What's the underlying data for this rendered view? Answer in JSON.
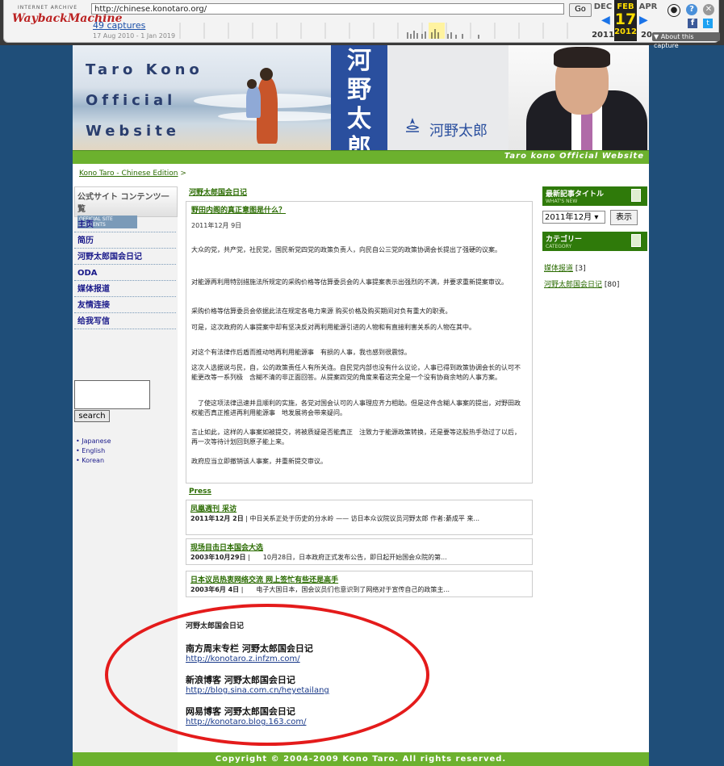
{
  "wayback": {
    "logo_line1": "INTERNET ARCHIVE",
    "logo_line2": "WaybackMachine",
    "url": "http://chinese.konotaro.org/",
    "go_label": "Go",
    "captures": "49 captures",
    "range": "17 Aug 2010 - 1 Jan 2019",
    "prev_month": "DEC",
    "prev_year": "2011",
    "cur_month": "FEB",
    "cur_day": "17",
    "cur_year": "2012",
    "next_month": "APR",
    "next_year": "20",
    "about": "▼ About this capture",
    "accent": "#ffde00"
  },
  "banner": {
    "title_lines": [
      "Taro Kono",
      "Official",
      "Website"
    ],
    "name_vertical": "河野太郎",
    "signature": "河野太郎",
    "tagline": "Taro kono Official Website"
  },
  "breadcrumb": {
    "link": "Kono Taro - Chinese Edition",
    "sep": ">"
  },
  "sidebar": {
    "heading": "公式サイト コンテンツ一覧",
    "subheading": "OFFICIAL SITE CONTENTS",
    "items": [
      "主页",
      "简历",
      "河野太郎国会日记",
      "ODA",
      "媒体报道",
      "友情连接",
      "给我写信"
    ],
    "search_label": "search",
    "languages": [
      "• Japanese",
      "• English",
      "• Korean"
    ]
  },
  "main": {
    "section_title": "河野太郎国会日记",
    "article": {
      "title": "野田内阁的真正意图是什么？",
      "date": "2011年12月 9日",
      "paragraphs": [
        "大众的党，共产党，社民党，国民新党四党的政策负责人，向民自公三党的政策协调会长提出了强硬的议案。",
        "对能源再利用特别措施法所规定的采购价格等估算委员会的人事提案表示出强烈的不满，并要求重新提案审议。",
        "采购价格等估算委员会依据此法在规定各电力来源 购买价格及购买期间对负有重大的职责。",
        "可是，这次政府的人事提案中却有坚决反对再利用能源引进的人物和有直接利害关系的人物在其中。",
        "对这个有法律作后盾而推动地再利用能源事　有损的人事，我也感到很震惊。",
        "这次人选据说与民，自，公的政策责任人有所关连。自民党内部也没有什么议论，人事已得到政策协调会长的认可不能更改等一系列极　含糊不清的非正面回答。从提案四党的角度来看这完全是一个没有协商余地的人事方案。",
        "　了使这项法律迅速并且顺利的实施，各党对国会认可的人事理应齐力相助。但是这件含糊人事案的提出，对野田政权能否真正推进再利用能源事　地发展将会带来疑问。",
        "言止如此，这样的人事案如被提交，将被质疑是否能真正　注致力于能源政策转换，还是要等这股热手劲过了以后，再一次等待计划回到原子能上来。",
        "政府应当立即撤销该人事案，并重新提交审议。"
      ]
    },
    "press_title": "Press",
    "press": [
      {
        "title": "凤凰週刊  采访",
        "date": "2011年12月 2日",
        "snippet": "| 中日关系正处于历史的分水岭 —— 访日本众议院议员河野太郎 作者:綦成平 来..."
      },
      {
        "title": "现场目击日本国会大选",
        "date": "2003年10月29日",
        "snippet": "|　　10月28日，日本政府正式发布公告，即日起开始国会众院的第..."
      },
      {
        "title": "日本议员热衷网络交流 网上签忙有些还是高手",
        "date": "2003年6月 4日",
        "snippet": "|　　电子大国日本，国会议员们也意识到了网络对于宣传自己的政策主..."
      }
    ]
  },
  "diary": {
    "heading": "河野太郎国会日记",
    "links": [
      {
        "title": "南方周末专栏 河野太郎国会日记",
        "url": "http://konotaro.z.infzm.com/"
      },
      {
        "title": "新浪博客 河野太郎国会日记",
        "url": "http://blog.sina.com.cn/heyetailang"
      },
      {
        "title": "网易博客 河野太郎国会日记",
        "url": "http://konotaro.blog.163.com/"
      }
    ]
  },
  "right": {
    "recent_title": "最新記事タイトル",
    "recent_sub": "WHAT'S NEW",
    "month_value": "2011年12月 ▾",
    "show_label": "表示",
    "category_title": "カテゴリー",
    "category_sub": "CATEGORY",
    "categories": [
      {
        "name": "媒体报道",
        "count": " [3]"
      },
      {
        "name": "河野太郎国会日记",
        "count": " [80]"
      }
    ]
  },
  "footer": "Copyright © 2004-2009 Kono Taro. All rights reserved.",
  "colors": {
    "green": "#6cb12e",
    "navy": "#2a4f9e",
    "background": "#1f4e79",
    "circle": "#e41b1b"
  }
}
